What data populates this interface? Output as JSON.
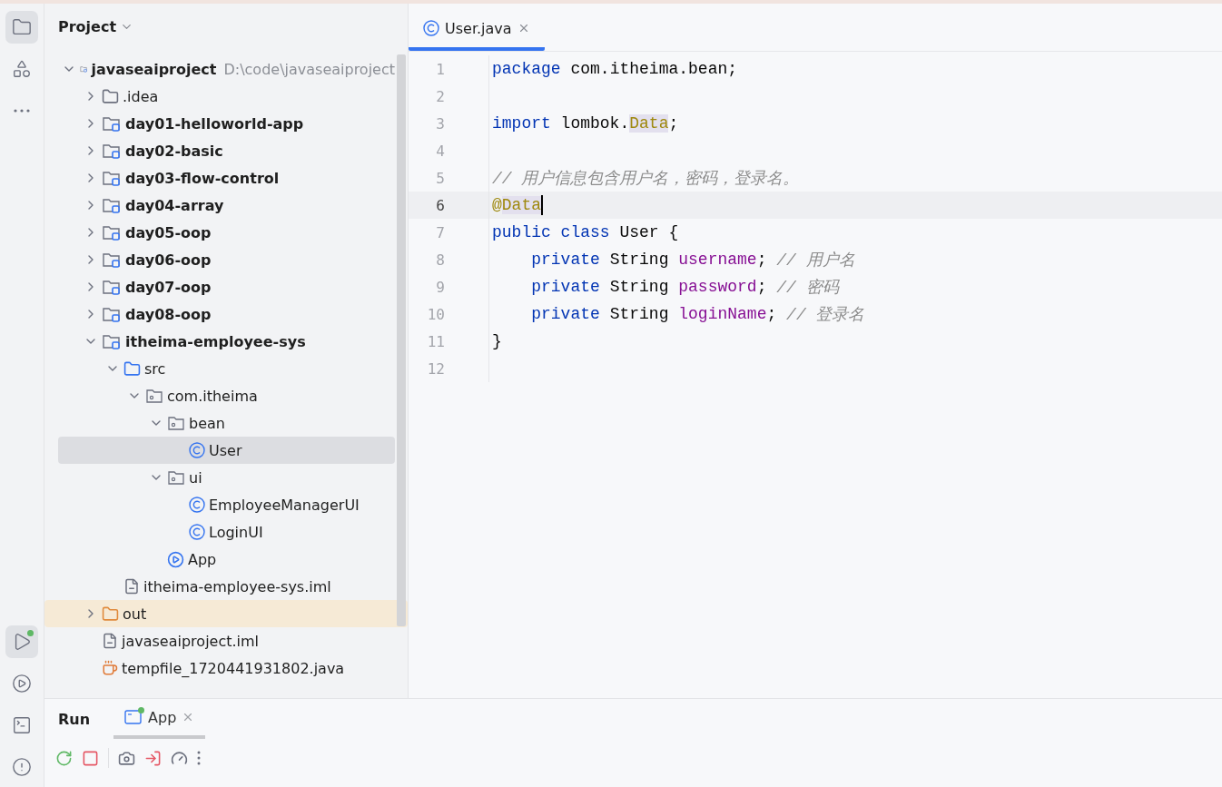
{
  "tool_strip": {
    "top": [
      {
        "kind": "project",
        "selected": true
      },
      {
        "kind": "structure",
        "selected": false
      },
      {
        "kind": "more",
        "selected": false
      }
    ],
    "bottom": [
      {
        "kind": "run",
        "selected": true,
        "running": true
      },
      {
        "kind": "services",
        "selected": false,
        "running": false
      },
      {
        "kind": "terminal",
        "selected": false,
        "running": false
      },
      {
        "kind": "problems",
        "selected": false,
        "running": false
      }
    ]
  },
  "project_panel": {
    "title": "Project",
    "tree": [
      {
        "label": "javaseaiproject",
        "path": "D:\\code\\javaseaiproject",
        "kind": "module",
        "expanded": true,
        "selected": false,
        "children": [
          {
            "label": ".idea",
            "kind": "folder",
            "expanded": false,
            "selected": false
          },
          {
            "label": "day01-helloworld-app",
            "kind": "module",
            "expanded": false,
            "selected": false
          },
          {
            "label": "day02-basic",
            "kind": "module",
            "expanded": false,
            "selected": false
          },
          {
            "label": "day03-flow-control",
            "kind": "module",
            "expanded": false,
            "selected": false
          },
          {
            "label": "day04-array",
            "kind": "module",
            "expanded": false,
            "selected": false
          },
          {
            "label": "day05-oop",
            "kind": "module",
            "expanded": false,
            "selected": false
          },
          {
            "label": "day06-oop",
            "kind": "module",
            "expanded": false,
            "selected": false
          },
          {
            "label": "day07-oop",
            "kind": "module",
            "expanded": false,
            "selected": false
          },
          {
            "label": "day08-oop",
            "kind": "module",
            "expanded": false,
            "selected": false
          },
          {
            "label": "itheima-employee-sys",
            "kind": "module",
            "expanded": true,
            "selected": false,
            "children": [
              {
                "label": "src",
                "kind": "source",
                "expanded": true,
                "selected": false,
                "children": [
                  {
                    "label": "com.itheima",
                    "kind": "package",
                    "expanded": true,
                    "selected": false,
                    "children": [
                      {
                        "label": "bean",
                        "kind": "package",
                        "expanded": true,
                        "selected": false,
                        "children": [
                          {
                            "label": "User",
                            "kind": "class",
                            "selected": true
                          }
                        ]
                      },
                      {
                        "label": "ui",
                        "kind": "package",
                        "expanded": true,
                        "selected": false,
                        "children": [
                          {
                            "label": "EmployeeManagerUI",
                            "kind": "class",
                            "selected": false
                          },
                          {
                            "label": "LoginUI",
                            "kind": "class",
                            "selected": false
                          }
                        ]
                      },
                      {
                        "label": "App",
                        "kind": "app",
                        "selected": false
                      }
                    ]
                  }
                ]
              },
              {
                "label": "itheima-employee-sys.iml",
                "kind": "iml",
                "selected": false
              }
            ]
          },
          {
            "label": "out",
            "kind": "excluded",
            "expanded": false,
            "selected": false
          },
          {
            "label": "javaseaiproject.iml",
            "kind": "iml",
            "selected": false
          },
          {
            "label": "tempfile_1720441931802.java",
            "kind": "java",
            "selected": false
          }
        ]
      }
    ]
  },
  "editor": {
    "tabs": [
      {
        "label": "User.java",
        "selected": true
      }
    ],
    "lines": [
      {
        "number": "1",
        "current": false,
        "tokens": [
          {
            "kind": "keyword",
            "text": "package"
          },
          {
            "kind": "plain",
            "text": " com.itheima.bean;"
          }
        ]
      },
      {
        "number": "2",
        "current": false
      },
      {
        "number": "3",
        "current": false,
        "tokens": [
          {
            "kind": "keyword",
            "text": "import"
          },
          {
            "kind": "plain",
            "text": " lombok."
          },
          {
            "kind": "annotation",
            "text": "Data",
            "highlight": true
          },
          {
            "kind": "plain",
            "text": ";"
          }
        ]
      },
      {
        "number": "4",
        "current": false
      },
      {
        "number": "5",
        "current": false,
        "tokens": [
          {
            "kind": "comment",
            "text": "// 用户信息包含用户名，密码，登录名。"
          }
        ]
      },
      {
        "number": "6",
        "current": true,
        "caret": true,
        "tokens": [
          {
            "kind": "annotation",
            "text": "@"
          },
          {
            "kind": "annotation",
            "text": "Data",
            "highlight": true
          }
        ]
      },
      {
        "number": "7",
        "current": false,
        "tokens": [
          {
            "kind": "keyword",
            "text": "public class"
          },
          {
            "kind": "plain",
            "text": " User {"
          }
        ]
      },
      {
        "number": "8",
        "current": false,
        "tokens": [
          {
            "kind": "keyword",
            "text": "    private"
          },
          {
            "kind": "plain",
            "text": " String "
          },
          {
            "kind": "field",
            "text": "username"
          },
          {
            "kind": "plain",
            "text": "; "
          },
          {
            "kind": "comment",
            "text": "// 用户名"
          }
        ]
      },
      {
        "number": "9",
        "current": false,
        "tokens": [
          {
            "kind": "keyword",
            "text": "    private"
          },
          {
            "kind": "plain",
            "text": " String "
          },
          {
            "kind": "field",
            "text": "password"
          },
          {
            "kind": "plain",
            "text": "; "
          },
          {
            "kind": "comment",
            "text": "// 密码"
          }
        ]
      },
      {
        "number": "10",
        "current": false,
        "tokens": [
          {
            "kind": "keyword",
            "text": "    private"
          },
          {
            "kind": "plain",
            "text": " String "
          },
          {
            "kind": "field",
            "text": "loginName"
          },
          {
            "kind": "plain",
            "text": "; "
          },
          {
            "kind": "comment",
            "text": "// 登录名"
          }
        ]
      },
      {
        "number": "11",
        "current": false,
        "tokens": [
          {
            "kind": "plain",
            "text": "}"
          }
        ]
      },
      {
        "number": "12",
        "current": false
      }
    ]
  },
  "run_panel": {
    "title": "Run",
    "tabs": [
      {
        "label": "App",
        "selected": true,
        "running": true
      }
    ],
    "toolbar": [
      {
        "kind": "rerun"
      },
      {
        "kind": "stop"
      },
      {
        "kind": "separator"
      },
      {
        "kind": "screenshot"
      },
      {
        "kind": "exit"
      },
      {
        "kind": "profiler"
      },
      {
        "kind": "more"
      }
    ]
  }
}
